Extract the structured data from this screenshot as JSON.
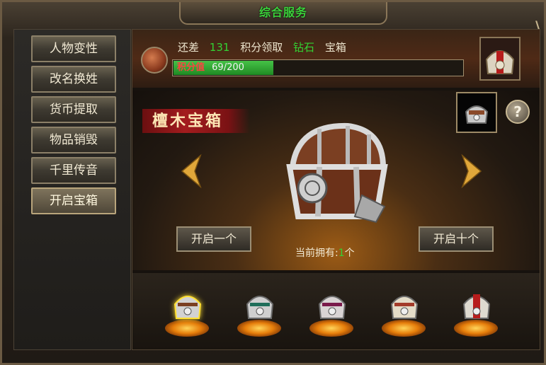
{
  "window": {
    "title": "综合服务",
    "close_icon": "close-icon"
  },
  "sidebar": {
    "items": [
      {
        "label": "人物变性"
      },
      {
        "label": "改名换姓"
      },
      {
        "label": "货币提取"
      },
      {
        "label": "物品销毁"
      },
      {
        "label": "千里传音"
      },
      {
        "label": "开启宝箱",
        "active": true
      }
    ]
  },
  "topbar": {
    "prefix": "还差",
    "amount": "131",
    "mid": "积分领取",
    "tier": "钻石",
    "suffix": "宝箱",
    "progress_label": "积分值",
    "progress_value": "69/200",
    "progress_fraction": 0.345
  },
  "stage": {
    "chest_name": "檀木宝箱",
    "help_label": "?",
    "open_one": "开启一个",
    "open_ten": "开启十个",
    "own_prefix": "当前拥有:",
    "own_count": "1",
    "own_suffix": "个"
  },
  "tray": {
    "chests": [
      {
        "name": "silver-chest",
        "selected": true
      },
      {
        "name": "jade-chest",
        "selected": false
      },
      {
        "name": "purple-chest",
        "selected": false
      },
      {
        "name": "gold-chest",
        "selected": false
      },
      {
        "name": "diamond-chest",
        "selected": false
      }
    ]
  },
  "colors": {
    "accent_green": "#33d233",
    "score_red": "#ff4141",
    "gold_border": "#8a7658"
  }
}
